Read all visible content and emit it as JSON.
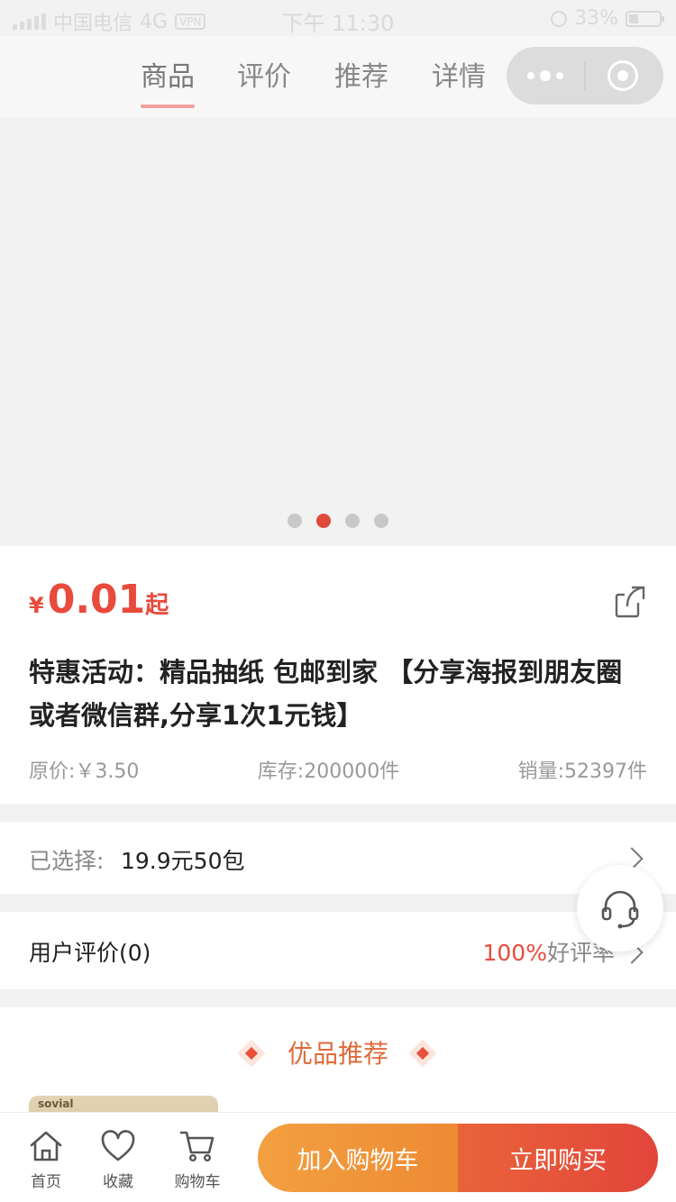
{
  "status_bar": {
    "carrier": "中国电信",
    "network": "4G",
    "vpn": "VPN",
    "time": "下午 11:30",
    "battery": "33%"
  },
  "tabs": [
    {
      "label": "商品",
      "active": true
    },
    {
      "label": "评价",
      "active": false
    },
    {
      "label": "推荐",
      "active": false
    },
    {
      "label": "详情",
      "active": false
    }
  ],
  "banner": {
    "page_count": 4,
    "active_index": 1
  },
  "product": {
    "currency": "¥",
    "price": "0.01",
    "price_suffix": "起",
    "title": "特惠活动：精品抽纸 包邮到家 【分享海报到朋友圈或者微信群,分享1次1元钱】",
    "original_price": "原价:￥3.50",
    "stock": "库存:200000件",
    "sales": "销量:52397件"
  },
  "selection": {
    "label": "已选择:",
    "value": "19.9元50包"
  },
  "reviews": {
    "label": "用户评价(0)",
    "rate_pct": "100%",
    "rate_text": "好评率"
  },
  "recommend": {
    "title": "优品推荐",
    "thumb_text": "sovial"
  },
  "bottom_nav": {
    "home": "首页",
    "favorite": "收藏",
    "cart": "购物车",
    "add_to_cart": "加入购物车",
    "buy_now": "立即购买"
  },
  "colors": {
    "accent_red": "#e84a3c",
    "cart_orange": "#ee8a34",
    "buy_red": "#e2453a",
    "recommend_orange": "#e06a3a"
  }
}
